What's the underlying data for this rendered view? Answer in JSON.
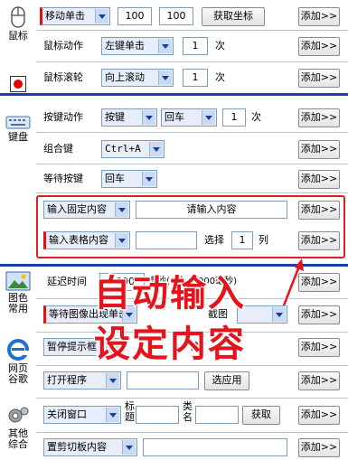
{
  "sidebar": {
    "mouse": "鼠标",
    "keyboard": "键盘",
    "image": "图色\n常用",
    "web": "网页\n谷歌",
    "other": "其他\n综合"
  },
  "mouse": {
    "move": {
      "action": "移动单击",
      "x": "100",
      "y": "100",
      "get_coords": "获取坐标",
      "add": "添加>>"
    },
    "action": {
      "label": "鼠标动作",
      "value": "左键单击",
      "count": "1",
      "unit": "次",
      "add": "添加>>"
    },
    "wheel": {
      "label": "鼠标滚轮",
      "value": "向上滚动",
      "count": "1",
      "unit": "次",
      "add": "添加>>"
    }
  },
  "keyboard": {
    "key_action": {
      "label": "按键动作",
      "type": "按键",
      "key": "回车",
      "count": "1",
      "unit": "次",
      "add": "添加>>"
    },
    "combo": {
      "label": "组合键",
      "value": "Ctrl+A",
      "add": "添加>>"
    },
    "wait_key": {
      "label": "等待按键",
      "value": "回车",
      "add": "添加>>"
    },
    "fixed_input": {
      "action": "输入固定内容",
      "placeholder": "请输入内容",
      "add": "添加>>"
    },
    "table_input": {
      "action": "输入表格内容",
      "value": "",
      "select": "选择",
      "col": "1",
      "unit": "列",
      "add": "添加>>"
    }
  },
  "image": {
    "delay": {
      "label": "延迟时间",
      "value": "1000",
      "suffix": "毫秒(1秒=1000毫秒)",
      "add": "添加>>"
    },
    "wait_image": {
      "action": "等待图像出现单击",
      "capture": "截图",
      "add": "添加>>"
    },
    "pause": {
      "action": "暂停提示框",
      "stop": "停",
      "add": "添加>>"
    }
  },
  "web": {
    "open": {
      "action": "打开程序",
      "choose_app": "选应用",
      "add": "添加>>"
    }
  },
  "other": {
    "close": {
      "action": "关闭窗口",
      "title_label": "标\n题",
      "class_label": "类\n名",
      "get": "获取",
      "add": "添加>>"
    },
    "clipboard": {
      "action": "置剪切板内容",
      "add": "添加>>"
    }
  },
  "overlay": {
    "line1": "自动输入",
    "line2": "设定内容"
  },
  "colors": {
    "accent": "#1a3fa8",
    "highlight": "#e02020"
  }
}
